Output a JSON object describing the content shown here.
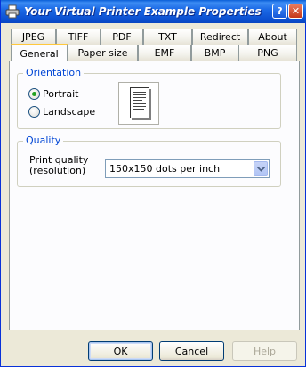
{
  "window": {
    "title": "Your Virtual Printer Example Properties",
    "help_label": "?",
    "close_label": "✕"
  },
  "tabs_row1": [
    {
      "label": "JPEG"
    },
    {
      "label": "TIFF"
    },
    {
      "label": "PDF"
    },
    {
      "label": "TXT"
    },
    {
      "label": "Redirect"
    },
    {
      "label": "About"
    }
  ],
  "tabs_row2": [
    {
      "label": "General",
      "active": true
    },
    {
      "label": "Paper size"
    },
    {
      "label": "EMF"
    },
    {
      "label": "BMP"
    },
    {
      "label": "PNG"
    }
  ],
  "orientation": {
    "group_title": "Orientation",
    "options": [
      {
        "label": "Portrait",
        "checked": true
      },
      {
        "label": "Landscape",
        "checked": false
      }
    ],
    "preview_icon": "portrait-page-icon"
  },
  "quality": {
    "group_title": "Quality",
    "label_line1": "Print quality",
    "label_line2": "(resolution)",
    "selected": "150x150 dots per inch"
  },
  "buttons": {
    "ok": "OK",
    "cancel": "Cancel",
    "help": "Help"
  },
  "colors": {
    "titlebar": "#0b4fd0",
    "group_title": "#0046d5",
    "active_tab_accent": "#ffc83c"
  }
}
